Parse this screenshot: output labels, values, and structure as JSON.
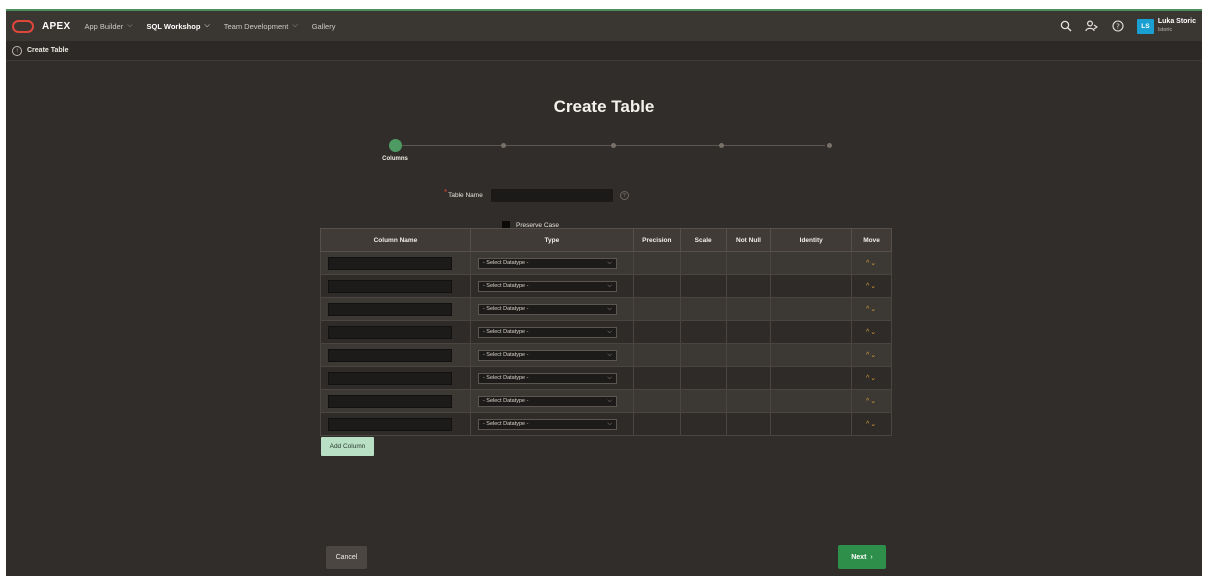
{
  "nav": {
    "brand": "APEX",
    "items": [
      {
        "label": "App Builder",
        "has_caret": true,
        "active": false
      },
      {
        "label": "SQL Workshop",
        "has_caret": true,
        "active": true
      },
      {
        "label": "Team Development",
        "has_caret": true,
        "active": false
      },
      {
        "label": "Gallery",
        "has_caret": false,
        "active": false
      }
    ],
    "user": {
      "initials": "LS",
      "name": "Luka Storic",
      "sub": "lstoric"
    }
  },
  "breadcrumb": {
    "label": "Create Table"
  },
  "page": {
    "title": "Create Table"
  },
  "wizard": {
    "steps": [
      "Columns",
      "",
      "",
      "",
      ""
    ],
    "active_index": 0
  },
  "form": {
    "table_name_label": "Table Name",
    "table_name_value": "",
    "preserve_case_label": "Preserve Case"
  },
  "grid": {
    "headers": [
      "Column Name",
      "Type",
      "Precision",
      "Scale",
      "Not Null",
      "Identity",
      "Move"
    ],
    "select_placeholder": "- Select Datatype -",
    "rows": 8
  },
  "buttons": {
    "add_column": "Add Column",
    "cancel": "Cancel",
    "next": "Next"
  },
  "colors": {
    "accent_green": "#2e8f4a",
    "brand_red": "#e0473b",
    "move_arrows": "#d9a03a",
    "avatar_blue": "#1a9fd3"
  }
}
